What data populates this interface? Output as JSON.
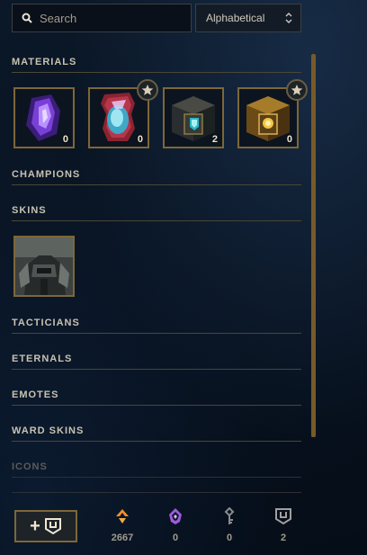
{
  "search": {
    "placeholder": "Search"
  },
  "sort": {
    "selected": "Alphabetical"
  },
  "sections": {
    "materials": "MATERIALS",
    "champions": "CHAMPIONS",
    "skins": "SKINS",
    "tacticians": "TACTICIANS",
    "eternals": "ETERNALS",
    "emotes": "EMOTES",
    "ward_skins": "WARD SKINS",
    "icons": "ICONS"
  },
  "materials": [
    {
      "icon": "purple-crystal-icon",
      "count": "0",
      "starred": false
    },
    {
      "icon": "mythic-orb-icon",
      "count": "0",
      "starred": true
    },
    {
      "icon": "hextech-chest-icon",
      "count": "2",
      "starred": false
    },
    {
      "icon": "masterwork-chest-icon",
      "count": "0",
      "starred": true
    }
  ],
  "skins": [
    {
      "icon": "armored-champion-skin"
    }
  ],
  "footer": {
    "currencies": [
      {
        "icon": "blue-essence-icon",
        "value": "2667",
        "color": "#f58f2a"
      },
      {
        "icon": "mythic-essence-icon",
        "value": "0",
        "color": "#b67fe3"
      },
      {
        "icon": "key-icon",
        "value": "0",
        "color": "#8b8b8b"
      },
      {
        "icon": "chest-icon",
        "value": "2",
        "color": "#a0a0a0"
      }
    ]
  },
  "colors": {
    "gold": "#7d6738",
    "text": "#c8c2b1",
    "background": "#081321"
  }
}
